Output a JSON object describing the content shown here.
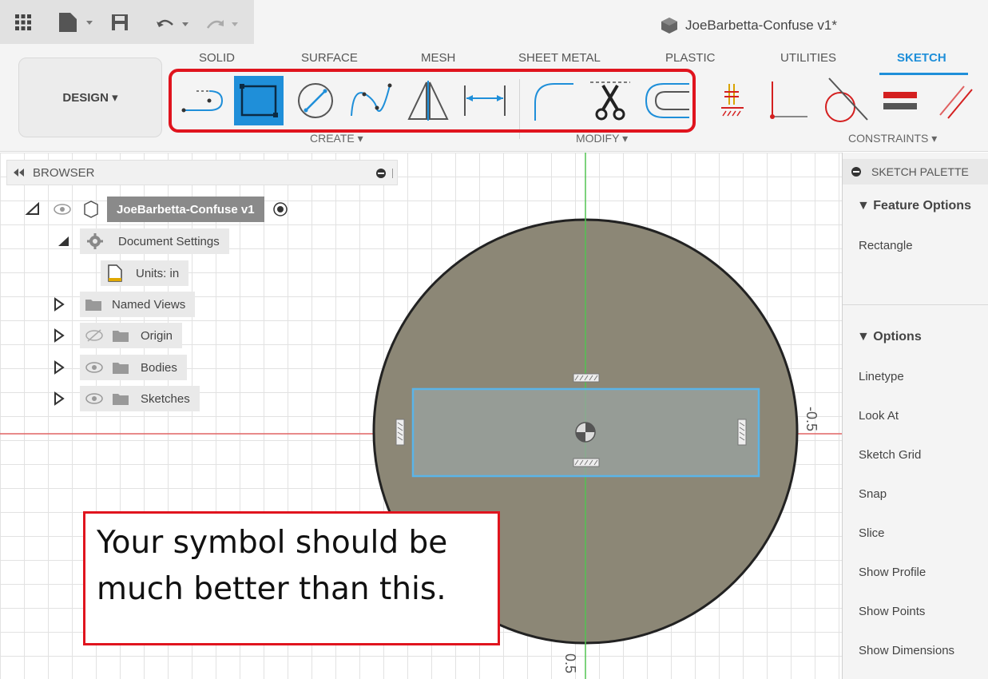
{
  "title_bar": {
    "document_title": "JoeBarbetta-Confuse v1*",
    "quick_access_icons": [
      "app-grid-icon",
      "file-icon",
      "save-icon",
      "undo-icon",
      "redo-icon"
    ]
  },
  "workspace": {
    "label": "DESIGN ▾"
  },
  "tabs": [
    {
      "label": "SOLID"
    },
    {
      "label": "SURFACE"
    },
    {
      "label": "MESH"
    },
    {
      "label": "SHEET METAL"
    },
    {
      "label": "PLASTIC"
    },
    {
      "label": "UTILITIES"
    },
    {
      "label": "SKETCH",
      "active": true
    }
  ],
  "tool_groups": {
    "create": "CREATE ▾",
    "modify": "MODIFY ▾",
    "constraints": "CONSTRAINTS ▾"
  },
  "tools": [
    {
      "icon": "slot-icon"
    },
    {
      "icon": "rectangle-icon",
      "active": true
    },
    {
      "icon": "circle-icon"
    },
    {
      "icon": "spline-icon"
    },
    {
      "icon": "mirror-icon"
    },
    {
      "icon": "dimension-icon"
    },
    {
      "icon": "fillet-icon"
    },
    {
      "icon": "trim-icon"
    },
    {
      "icon": "offset-icon"
    },
    {
      "icon": "horizontal-vertical-constraint-icon"
    },
    {
      "icon": "coincident-constraint-icon"
    },
    {
      "icon": "tangent-constraint-icon"
    },
    {
      "icon": "equal-constraint-icon"
    },
    {
      "icon": "parallel-constraint-icon"
    }
  ],
  "browser": {
    "title": "BROWSER",
    "root": "JoeBarbetta-Confuse v1",
    "items": [
      {
        "label": "Document Settings"
      },
      {
        "label": "Units: in"
      },
      {
        "label": "Named Views"
      },
      {
        "label": "Origin"
      },
      {
        "label": "Bodies"
      },
      {
        "label": "Sketches"
      }
    ]
  },
  "canvas": {
    "dimension_right": "-0.5",
    "dimension_bottom": "0.5"
  },
  "palette": {
    "title": "SKETCH PALETTE",
    "feature_options_title": "▼ Feature Options",
    "feature": "Rectangle",
    "options_title": "▼ Options",
    "options": [
      "Linetype",
      "Look At",
      "Sketch Grid",
      "Snap",
      "Slice",
      "Show Profile",
      "Show Points",
      "Show Dimensions"
    ]
  },
  "callout": {
    "line1": "Your symbol should be",
    "line2": "much better than this."
  },
  "colors": {
    "accent": "#1f8fd9",
    "highlight": "#e0141e",
    "disk_fill": "#8c8776",
    "sketch_rect": "#5ab4e8"
  }
}
